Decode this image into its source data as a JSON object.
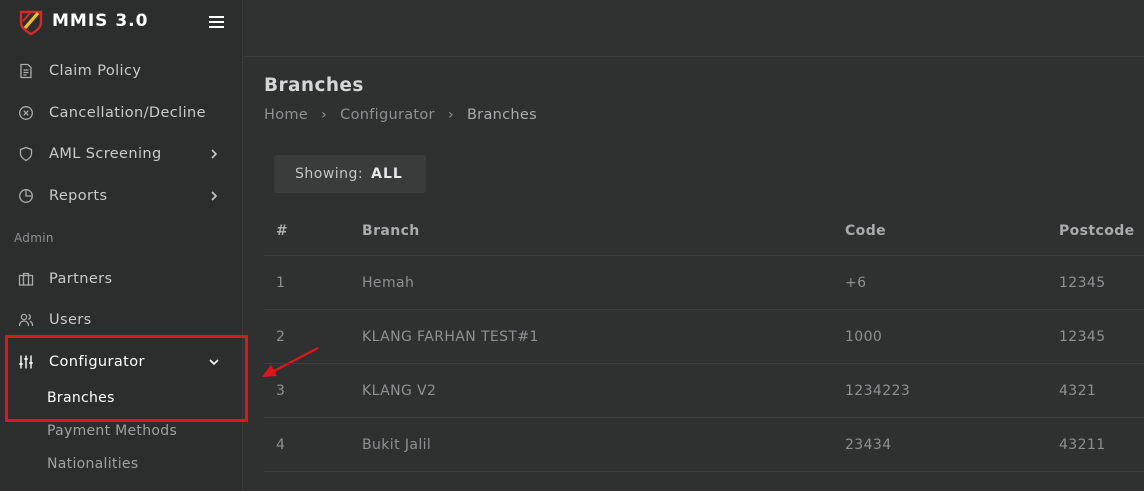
{
  "app": {
    "title": "MMIS 3.0"
  },
  "sidebar": {
    "items": [
      {
        "label": "Claim Policy",
        "icon": "document-icon"
      },
      {
        "label": "Cancellation/Decline",
        "icon": "x-circle-icon"
      },
      {
        "label": "AML Screening",
        "icon": "shield-icon"
      },
      {
        "label": "Reports",
        "icon": "pie-chart-icon"
      }
    ],
    "section_label": "Admin",
    "admin_items": [
      {
        "label": "Partners",
        "icon": "briefcase-icon"
      },
      {
        "label": "Users",
        "icon": "users-icon"
      },
      {
        "label": "Configurator",
        "icon": "sliders-icon"
      }
    ],
    "configurator_sub": [
      {
        "label": "Branches"
      },
      {
        "label": "Payment Methods"
      },
      {
        "label": "Nationalities"
      }
    ]
  },
  "page": {
    "title": "Branches",
    "breadcrumb": [
      "Home",
      "Configurator",
      "Branches"
    ],
    "breadcrumb_sep": "›",
    "filter": {
      "label": "Showing:",
      "value": "ALL"
    }
  },
  "table": {
    "headers": [
      "#",
      "Branch",
      "Code",
      "Postcode"
    ],
    "rows": [
      [
        "1",
        "Hemah",
        "+6",
        "12345"
      ],
      [
        "2",
        "KLANG FARHAN TEST#1",
        "1000",
        "12345"
      ],
      [
        "3",
        "KLANG V2",
        "1234223",
        "4321"
      ],
      [
        "4",
        "Bukit Jalil",
        "23434",
        "43211"
      ]
    ]
  },
  "colors": {
    "highlight": "#e0161c",
    "background": "#2f3030",
    "sidebar": "#2c2d2d"
  }
}
